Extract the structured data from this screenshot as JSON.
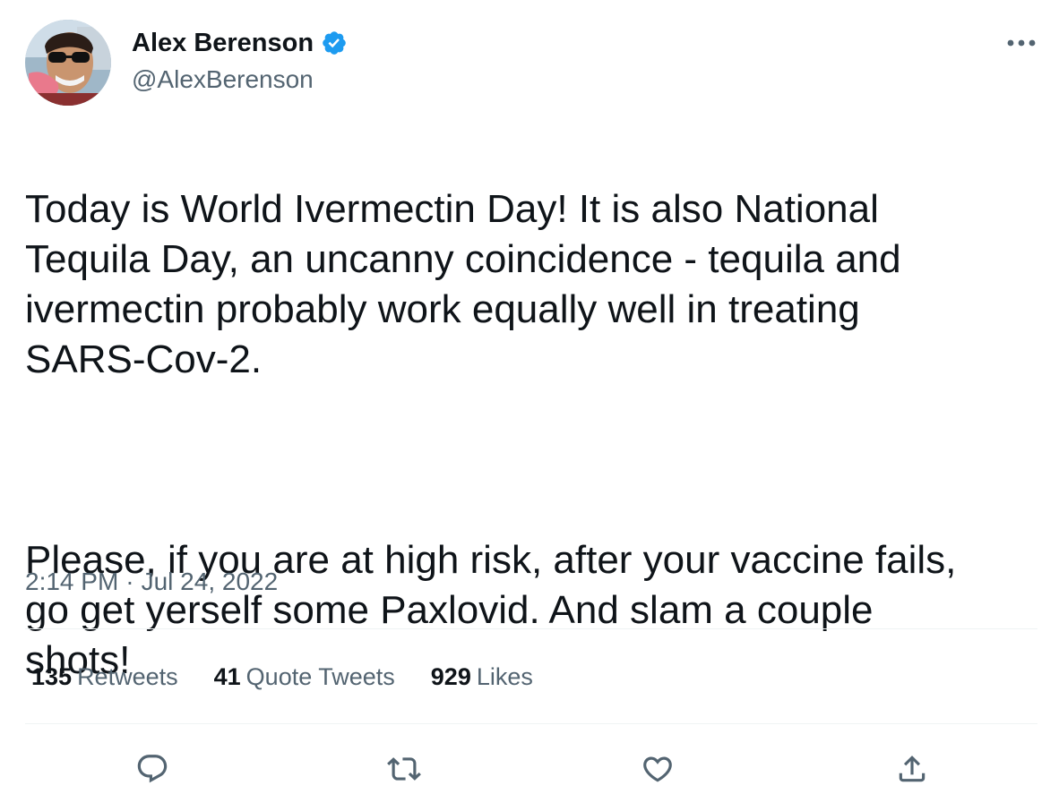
{
  "user": {
    "display_name": "Alex Berenson",
    "handle": "@AlexBerenson",
    "verified_icon": "verified-badge-icon",
    "avatar_description": "profile-photo"
  },
  "tweet": {
    "paragraph_1": "Today is World Ivermectin Day! It is also National\nTequila Day, an uncanny coincidence - tequila and\nivermectin probably work equally well in treating\nSARS-Cov-2.",
    "paragraph_2": "Please, if you are at high risk, after your vaccine fails,\ngo get yerself some Paxlovid. And slam a couple\nshots!",
    "time": "2:14 PM",
    "separator": "·",
    "date": "Jul 24, 2022"
  },
  "stats": {
    "retweets_count": "135",
    "retweets_label": "Retweets",
    "quote_tweets_count": "41",
    "quote_tweets_label": "Quote Tweets",
    "likes_count": "929",
    "likes_label": "Likes"
  },
  "actions": {
    "reply": "reply-icon",
    "retweet": "retweet-icon",
    "like": "heart-icon",
    "share": "share-icon"
  },
  "colors": {
    "text_primary": "#0f1419",
    "text_secondary": "#536471",
    "verified_blue": "#1d9bf0",
    "divider": "#eff3f4"
  }
}
